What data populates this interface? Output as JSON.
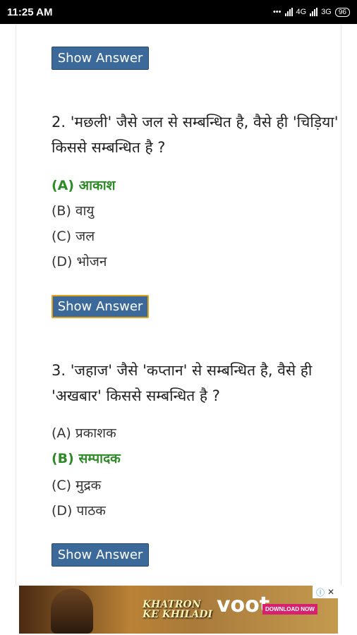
{
  "status_bar": {
    "time": "11:25 AM",
    "network_4g": "4G",
    "network_3g": "3G",
    "battery": "96"
  },
  "buttons": {
    "show_answer": "Show Answer"
  },
  "questions": [
    {
      "text": "2. 'मछली' जैसे जल से सम्बन्धित है, वैसे ही 'चिड़िया' किससे सम्बन्धित है ?",
      "options": [
        "(A) आकाश",
        "(B) वायु",
        "(C) जल",
        "(D) भोजन"
      ],
      "correct_index": 0
    },
    {
      "text": "3. 'जहाज' जैसे 'कप्तान' से सम्बन्धित है, वैसे ही 'अखबार' किससे सम्बन्धित है ?",
      "options": [
        "(A) प्रकाशक",
        "(B) सम्पादक",
        "(C) मुद्रक",
        "(D) पाठक"
      ],
      "correct_index": 1
    }
  ],
  "ad": {
    "logo_line1": "KHATRON",
    "logo_line2": "KE KHILADI",
    "brand": "voot",
    "cta": "DOWNLOAD NOW",
    "info_icon": "ⓘ",
    "close_icon": "✕"
  },
  "colors": {
    "button_bg": "#3b6a9a",
    "correct": "#2e8b27",
    "focus_border": "#e5a21b"
  }
}
